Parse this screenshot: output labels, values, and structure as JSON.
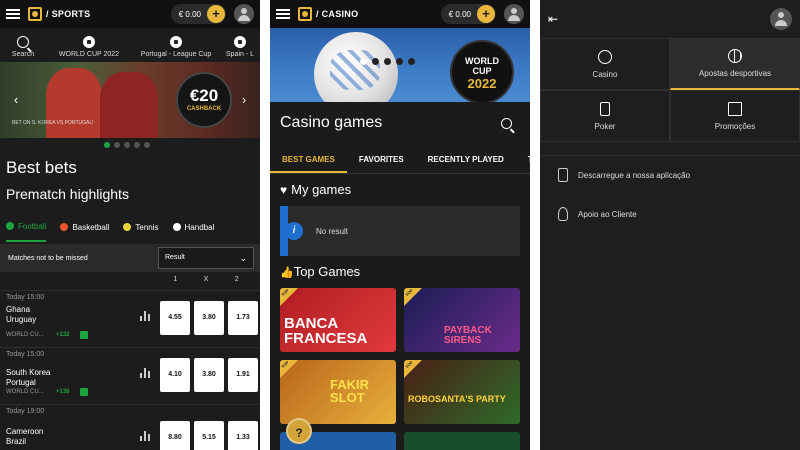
{
  "sports": {
    "section": "/ SPORTS",
    "balance": "€ 0.00",
    "plus": "+",
    "quicknav": [
      "Search",
      "WORLD CUP 2022",
      "Portugal - League Cup",
      "Spain - L"
    ],
    "banner": {
      "amount": "€20",
      "label": "CASHBACK",
      "caption": "BET ON S. KOREA VS PORTUGAL!",
      "prev": "‹",
      "next": "›"
    },
    "best_bets": "Best bets",
    "prematch": "Prematch highlights",
    "tabs": [
      {
        "label": "Football",
        "color": "#1fa33f"
      },
      {
        "label": "Basketball",
        "color": "#e8542c"
      },
      {
        "label": "Tennis",
        "color": "#e8d33c"
      },
      {
        "label": "Handbal",
        "color": "#ffffff"
      }
    ],
    "filter_label": "Matches not to be missed",
    "filter_value": "Result",
    "filter_chevron": "⌄",
    "odds_headers": [
      "1",
      "X",
      "2"
    ],
    "matches": [
      {
        "time": "Today 15:00",
        "home": "Ghana",
        "away": "Uruguay",
        "comp": "WORLD CU...",
        "more": "+132",
        "odds": [
          "4.55",
          "3.80",
          "1.73"
        ]
      },
      {
        "time": "Today 15:00",
        "home": "South Korea",
        "away": "Portugal",
        "comp": "WORLD CU...",
        "more": "+136",
        "odds": [
          "4.10",
          "3.80",
          "1.91"
        ]
      },
      {
        "time": "Today 19:00",
        "home": "Cameroon",
        "away": "Brazil",
        "comp": "",
        "more": "",
        "odds": [
          "8.80",
          "5.15",
          "1.33"
        ]
      }
    ]
  },
  "casino": {
    "section": "/ CASINO",
    "balance": "€ 0.00",
    "plus": "+",
    "banner": {
      "line1": "WORLD",
      "line2": "CUP",
      "line3": "2022"
    },
    "title": "Casino games",
    "tabs": [
      "BEST GAMES",
      "FAVORITES",
      "RECENTLY PLAYED",
      "T"
    ],
    "my_games": "My games",
    "no_result": "No result",
    "info": "i",
    "top_games": "Top Games",
    "top_tag": "TOP",
    "help": "?",
    "games": [
      {
        "name": "BANCA FRANCESA",
        "bg": "#c5252c"
      },
      {
        "name": "PAYBACK SIRENS",
        "bg": "#2a2f7a"
      },
      {
        "name": "FAKIR SLOT",
        "bg": "#d58a1a"
      },
      {
        "name": "ROBOSANTA'S PARTY",
        "bg": "#6b2a1a"
      }
    ]
  },
  "menu": {
    "collapse": "⇤",
    "items": [
      "Casino",
      "Apostas desportivas",
      "Poker",
      "Promoções"
    ],
    "active_index": 1,
    "links": [
      "Descarregue a nossa aplicação",
      "Apoio ao Cliente"
    ]
  },
  "colors": {
    "accent": "#e8b73c",
    "green": "#1fa33f",
    "blue": "#1f6fd1"
  }
}
